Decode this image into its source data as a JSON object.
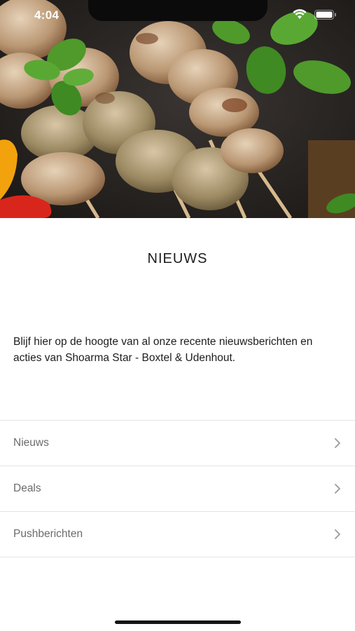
{
  "status_bar": {
    "time": "4:04",
    "icons": [
      "wifi-icon",
      "battery-icon"
    ]
  },
  "hero": {
    "image": "grilled-chicken-skewers-with-basil",
    "colors": {
      "background": "#2a2623",
      "meat": "#c9a98a",
      "basil": "#4f9a2a",
      "pepper_red": "#d9261c",
      "pepper_yellow": "#f2a20c"
    }
  },
  "page": {
    "title": "NIEUWS",
    "intro": "Blijf hier op de hoogte van al onze recente nieuwsberichten en acties van Shoarma Star - Boxtel & Udenhout."
  },
  "menu": {
    "items": [
      {
        "label": "Nieuws",
        "icon": "chevron-right-icon"
      },
      {
        "label": "Deals",
        "icon": "chevron-right-icon"
      },
      {
        "label": "Pushberichten",
        "icon": "chevron-right-icon"
      }
    ]
  }
}
